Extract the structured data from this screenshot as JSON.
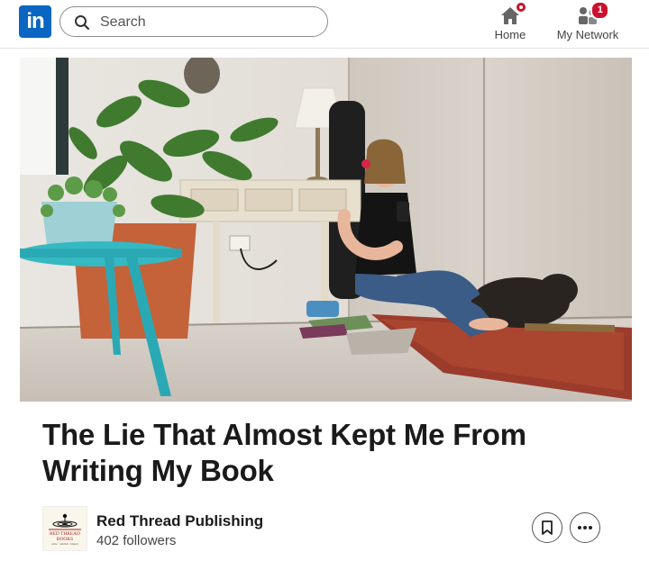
{
  "nav": {
    "logo_text": "in",
    "search_placeholder": "Search",
    "home_label": "Home",
    "network_label": "My Network",
    "network_badge": "1"
  },
  "article": {
    "title": "The Lie That Almost Kept Me From Writing My Book"
  },
  "publisher": {
    "name": "Red Thread Publishing",
    "followers": "402 followers",
    "logo_line1": "RED THREAD",
    "logo_line2": "BOOKS",
    "logo_line3": "write · publish · impact"
  },
  "colors": {
    "brand": "#0a66c2",
    "badge": "#cb112d"
  }
}
